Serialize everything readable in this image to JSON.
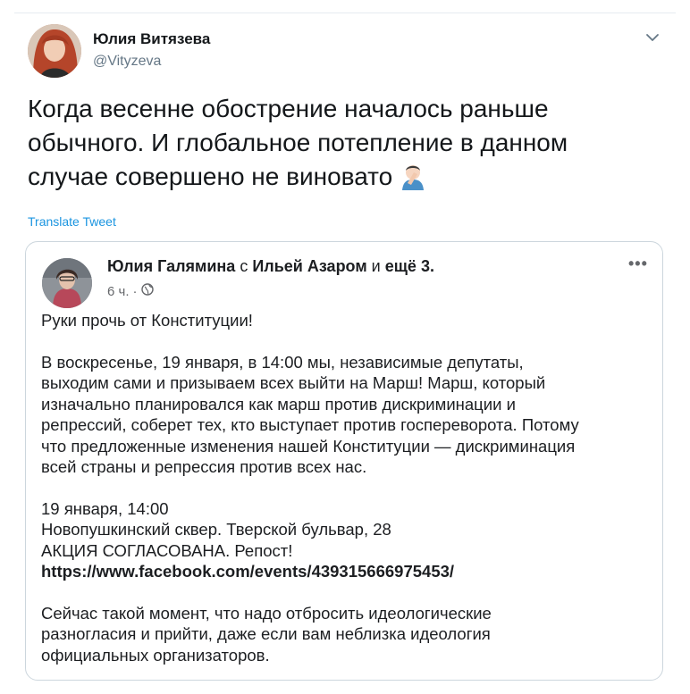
{
  "tweet": {
    "author_name": "Юлия Витязева",
    "author_handle": "@Vityzeva",
    "text": "Когда весенне обострение началось раньше обычного. И глобальное потепление в данном случае совершено не виновато",
    "emoji": "face-palm-emoji",
    "translate_label": "Translate Tweet"
  },
  "embedded_post": {
    "author": "Юлия Галямина",
    "with_word": "с",
    "tagged": "Ильей Азаром",
    "and_word": "и",
    "others": "ещё 3",
    "time": "6 ч.",
    "separator": "·",
    "visibility_icon": "globe-icon",
    "more_icon": "more-dots-icon",
    "paragraphs": [
      [
        "Руки прочь от Конституции!"
      ],
      [
        "В воскресенье, 19 января, в 14:00 мы, независимые депутаты,",
        "выходим сами и призываем всех выйти на Марш! Марш, который",
        "изначально планировался как марш против дискриминации и",
        "репрессий, соберет тех, кто выступает против госпереворота. Потому",
        "что предложенные изменения нашей Конституции — дискриминация",
        "всей страны и репрессия против всех нас."
      ],
      [
        "19 января, 14:00",
        "Новопушкинский сквер. Тверской бульвар, 28",
        "АКЦИЯ СОГЛАСОВАНА. Репост!"
      ],
      [
        "Сейчас такой момент, что надо отбросить идеологические",
        "разногласия и прийти, даже если вам неблизка идеология",
        "официальных организаторов."
      ]
    ],
    "link": "https://www.facebook.com/events/439315666975453/"
  },
  "colors": {
    "text": "#14171a",
    "secondary": "#657786",
    "link_blue": "#1b95e0",
    "border": "#ccd6dd"
  }
}
